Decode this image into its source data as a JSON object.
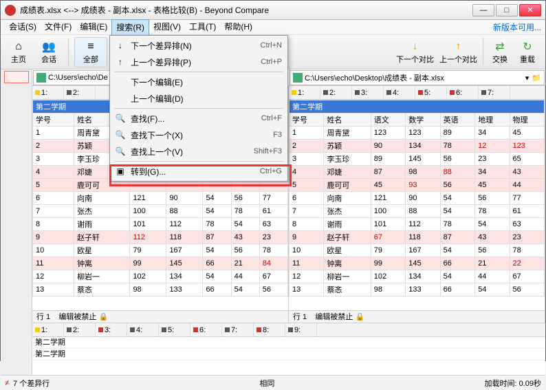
{
  "title": "成绩表.xlsx <--> 成绩表 - 副本.xlsx - 表格比较(B) - Beyond Compare",
  "menubar": {
    "items": [
      "会话(S)",
      "文件(F)",
      "编辑(E)",
      "搜索(R)",
      "视图(V)",
      "工具(T)",
      "帮助(H)"
    ],
    "open_index": 3,
    "update_link": "新版本可用..."
  },
  "toolbar": {
    "home": "主页",
    "session": "会话",
    "all": "全部",
    "next_diff": "下一个对比",
    "prev_diff": "上一个对比",
    "swap": "交换",
    "reload": "重载"
  },
  "paths": {
    "left": "C:\\Users\\echo\\De",
    "right": "C:\\Users\\echo\\Desktop\\成绩表 - 副本.xlsx"
  },
  "dropdown": {
    "items": [
      {
        "icon": "↓",
        "label": "下一个差异排(N)",
        "key": "Ctrl+N"
      },
      {
        "icon": "↑",
        "label": "上一个差异排(P)",
        "key": "Ctrl+P"
      },
      {
        "sep": true
      },
      {
        "icon": "",
        "label": "下一个编辑(E)",
        "key": ""
      },
      {
        "icon": "",
        "label": "上一个编辑(D)",
        "key": ""
      },
      {
        "sep": true
      },
      {
        "icon": "🔍",
        "label": "查找(F)...",
        "key": "Ctrl+F"
      },
      {
        "icon": "🔍",
        "label": "查找下一个(X)",
        "key": "F3"
      },
      {
        "icon": "🔍",
        "label": "查找上一个(V)",
        "key": "Shift+F3"
      },
      {
        "sep": true
      },
      {
        "icon": "▣",
        "label": "转到(G)...",
        "key": "Ctrl+G"
      }
    ]
  },
  "colheaders_left": [
    {
      "c": "#fc0",
      "t": "1:"
    },
    {
      "c": "#555",
      "t": "2:"
    }
  ],
  "colheaders_right": [
    {
      "c": "#fc0",
      "t": "1:"
    },
    {
      "c": "#555",
      "t": "2:"
    },
    {
      "c": "#555",
      "t": "3:"
    },
    {
      "c": "#555",
      "t": "4:"
    },
    {
      "c": "#c33",
      "t": "5:"
    },
    {
      "c": "#c33",
      "t": "6:"
    },
    {
      "c": "#555",
      "t": "7:"
    }
  ],
  "left": {
    "sheet_row": "第二学期",
    "header": [
      "学号",
      "姓名",
      "",
      "",
      "",
      "",
      ""
    ],
    "rows": [
      {
        "d": false,
        "c": [
          "1",
          "周青黛",
          "",
          "",
          "",
          "",
          ""
        ]
      },
      {
        "d": true,
        "c": [
          "2",
          "苏颖",
          "",
          "",
          "",
          "",
          ""
        ]
      },
      {
        "d": false,
        "c": [
          "3",
          "李玉珍",
          "",
          "",
          "",
          "",
          ""
        ]
      },
      {
        "d": true,
        "c": [
          "4",
          "邓婕",
          "",
          "",
          "",
          "",
          ""
        ]
      },
      {
        "d": true,
        "c": [
          "5",
          "鹿可可",
          "",
          "",
          "",
          "",
          ""
        ]
      },
      {
        "d": false,
        "c": [
          "6",
          "向南",
          "121",
          "90",
          "54",
          "56",
          "77"
        ]
      },
      {
        "d": false,
        "c": [
          "7",
          "张杰",
          "100",
          "88",
          "54",
          "78",
          "61"
        ]
      },
      {
        "d": false,
        "c": [
          "8",
          "谢雨",
          "101",
          "112",
          "78",
          "54",
          "63"
        ]
      },
      {
        "d": true,
        "c": [
          "9",
          "赵子轩",
          "112",
          "118",
          "87",
          "43",
          "23"
        ],
        "rc": [
          2
        ]
      },
      {
        "d": false,
        "c": [
          "10",
          "欧星",
          "79",
          "167",
          "54",
          "56",
          "78"
        ]
      },
      {
        "d": true,
        "c": [
          "11",
          "钟离",
          "99",
          "145",
          "66",
          "21",
          "84"
        ],
        "rc": [
          6
        ]
      },
      {
        "d": false,
        "c": [
          "12",
          "柳岩一",
          "102",
          "134",
          "54",
          "44",
          "67"
        ]
      },
      {
        "d": false,
        "c": [
          "13",
          "蔡忞",
          "98",
          "133",
          "66",
          "54",
          "56"
        ]
      }
    ]
  },
  "right": {
    "sheet_row": "第二学期",
    "header": [
      "学号",
      "姓名",
      "语文",
      "数学",
      "英语",
      "地理",
      "物理"
    ],
    "rows": [
      {
        "d": false,
        "c": [
          "1",
          "周青黛",
          "123",
          "123",
          "89",
          "34",
          "45"
        ]
      },
      {
        "d": true,
        "c": [
          "2",
          "苏颖",
          "90",
          "134",
          "78",
          "12",
          "123"
        ],
        "rc": [
          5,
          6
        ]
      },
      {
        "d": false,
        "c": [
          "3",
          "李玉珍",
          "89",
          "145",
          "56",
          "23",
          "65"
        ]
      },
      {
        "d": true,
        "c": [
          "4",
          "邓婕",
          "87",
          "98",
          "88",
          "34",
          "43"
        ],
        "rc": [
          4
        ]
      },
      {
        "d": true,
        "c": [
          "5",
          "鹿可可",
          "45",
          "93",
          "56",
          "45",
          "44"
        ],
        "rc": [
          3
        ]
      },
      {
        "d": false,
        "c": [
          "6",
          "向南",
          "121",
          "90",
          "54",
          "56",
          "77"
        ]
      },
      {
        "d": false,
        "c": [
          "7",
          "张杰",
          "100",
          "88",
          "54",
          "78",
          "61"
        ]
      },
      {
        "d": false,
        "c": [
          "8",
          "谢雨",
          "101",
          "112",
          "78",
          "54",
          "63"
        ]
      },
      {
        "d": true,
        "c": [
          "9",
          "赵子轩",
          "67",
          "118",
          "87",
          "43",
          "23"
        ],
        "rc": [
          2
        ]
      },
      {
        "d": false,
        "c": [
          "10",
          "欧星",
          "79",
          "167",
          "54",
          "56",
          "78"
        ]
      },
      {
        "d": true,
        "c": [
          "11",
          "钟离",
          "99",
          "145",
          "66",
          "21",
          "22"
        ],
        "rc": [
          6
        ]
      },
      {
        "d": false,
        "c": [
          "12",
          "柳岩一",
          "102",
          "134",
          "54",
          "44",
          "67"
        ]
      },
      {
        "d": false,
        "c": [
          "13",
          "蔡忞",
          "98",
          "133",
          "66",
          "54",
          "56"
        ]
      }
    ]
  },
  "footer": {
    "left_row": "行 1",
    "right_row": "行 1",
    "locked": "编辑被禁止"
  },
  "bottom_headers": [
    {
      "c": "#fc0",
      "t": "1:"
    },
    {
      "c": "#555",
      "t": "2:"
    },
    {
      "c": "#c33",
      "t": "3:"
    },
    {
      "c": "#555",
      "t": "4:"
    },
    {
      "c": "#555",
      "t": "5:"
    },
    {
      "c": "#c33",
      "t": "6:"
    },
    {
      "c": "#555",
      "t": "7:"
    },
    {
      "c": "#c33",
      "t": "8:"
    },
    {
      "c": "#555",
      "t": "9:"
    }
  ],
  "bottom_rows": [
    "第二学期",
    "第二学期"
  ],
  "status": {
    "diff": "7 个差异行",
    "mid": "相同",
    "load": "加载时间: 0.09秒"
  }
}
